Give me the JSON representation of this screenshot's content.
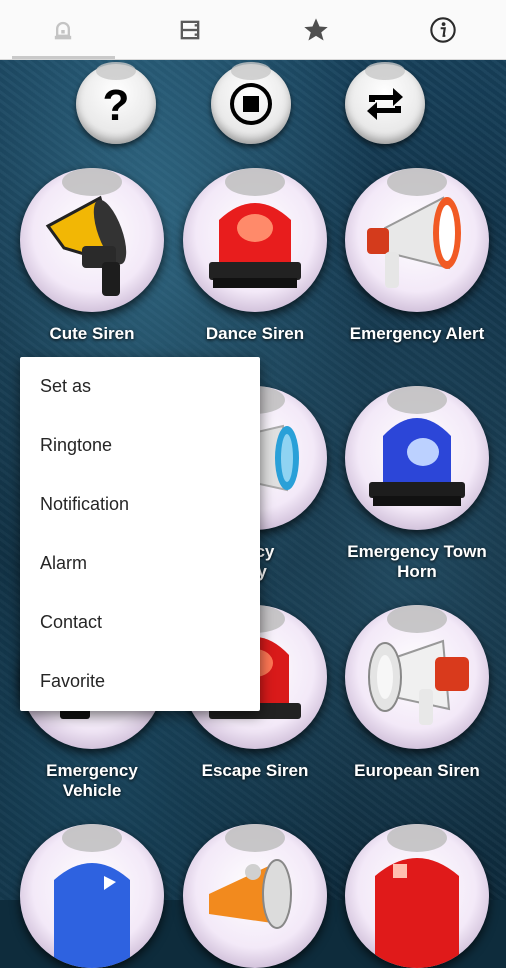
{
  "tabs": [
    {
      "name": "sirens",
      "icon": "siren-icon",
      "active": true
    },
    {
      "name": "list",
      "icon": "list-icon",
      "active": false
    },
    {
      "name": "favorites",
      "icon": "star-icon",
      "active": false
    },
    {
      "name": "info",
      "icon": "info-icon",
      "active": false
    }
  ],
  "controls": [
    {
      "icon": "help-icon"
    },
    {
      "icon": "stop-icon"
    },
    {
      "icon": "repeat-icon"
    }
  ],
  "sounds": [
    {
      "label": "Cute Siren",
      "icon": "megaphone-yellow-icon"
    },
    {
      "label": "Dance Siren",
      "icon": "red-beacon-icon"
    },
    {
      "label": "Emergency Alert",
      "icon": "megaphone-red-icon"
    },
    {
      "label": "Emergency Valley",
      "visible_label": "ency\nley",
      "icon": "megaphone-blue-icon"
    },
    {
      "label": "Emergency Town Horn",
      "icon": "blue-beacon-icon"
    },
    {
      "label": "Emergency Vehicle",
      "icon": "police-light-icon"
    },
    {
      "label": "Escape Siren",
      "icon": "red-beacon-icon"
    },
    {
      "label": "European Siren",
      "icon": "megaphone-red-icon"
    }
  ],
  "menu": {
    "title": "Set as",
    "items": [
      "Ringtone",
      "Notification",
      "Alarm",
      "Contact",
      "Favorite"
    ]
  },
  "colors": {
    "accent": "#1e3d52",
    "menu_text": "#262626",
    "label": "#ffffff"
  }
}
